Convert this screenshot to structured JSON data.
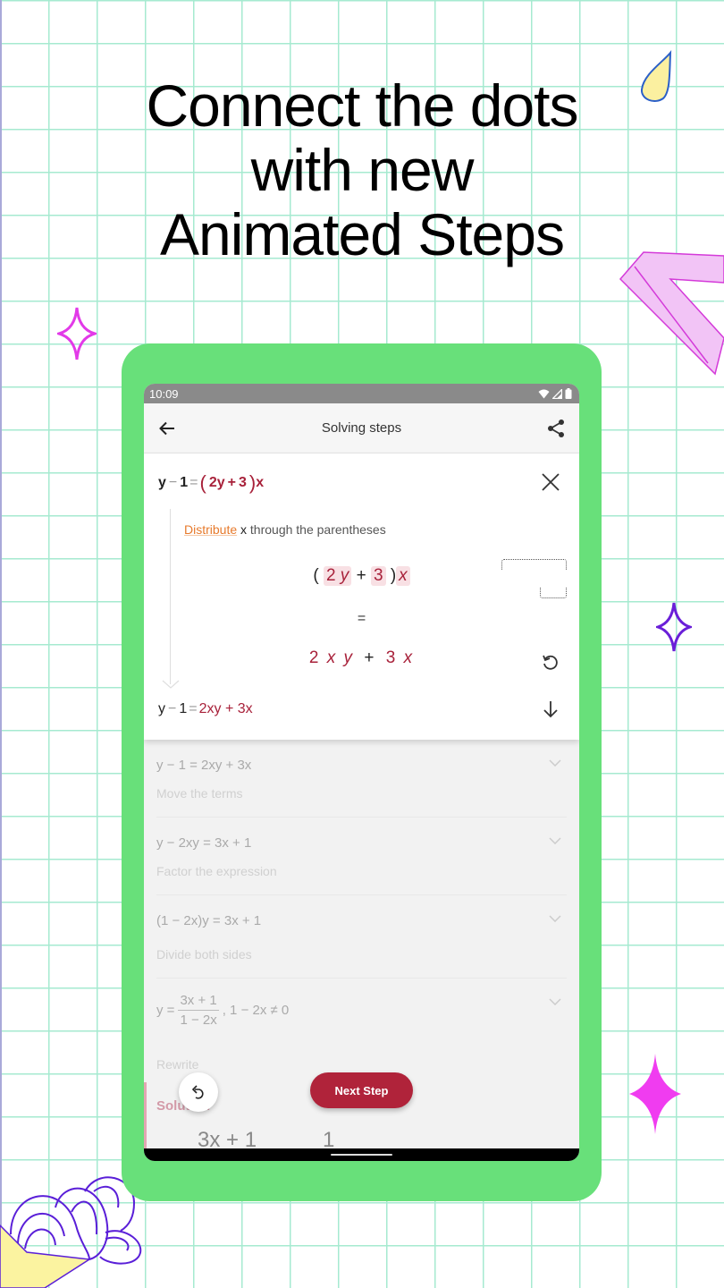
{
  "headline": {
    "line1": "Connect the dots",
    "line2": "with new",
    "line3": "Animated Steps"
  },
  "colors": {
    "frame_green": "#68e07a",
    "grid_line": "#a6ead0",
    "accent_red": "#b0233a",
    "math_red": "#a8213a",
    "keyword_orange": "#e77a2c"
  },
  "status_bar": {
    "time": "10:09",
    "icons": [
      "wifi-icon",
      "signal-icon",
      "battery-icon"
    ]
  },
  "app_bar": {
    "back_icon": "arrow-left-icon",
    "title": "Solving steps",
    "share_icon": "share-icon"
  },
  "active_step": {
    "equation": {
      "lhs_y": "y",
      "minus": "−",
      "one": "1",
      "equals": "=",
      "open_paren": "(",
      "term_2y": "2y",
      "plus": "+",
      "three": "3",
      "close_paren": ")",
      "x": "x"
    },
    "instruction": {
      "keyword": "Distribute",
      "variable": "x",
      "rest": "through the parentheses"
    },
    "animation": {
      "open_paren": "(",
      "term1_coef": "2",
      "term1_var": "y",
      "plus": "+",
      "term2": "3",
      "close_paren": ")",
      "multiplier": "x",
      "equals": "=",
      "result_t1_coef": "2",
      "result_t1_vars": "x y",
      "result_plus": "+",
      "result_t2_coef": "3",
      "result_t2_var": "x"
    },
    "result_equation": {
      "lhs": "y",
      "minus": "−",
      "one": "1",
      "equals": "=",
      "rhs": "2xy + 3x"
    },
    "close_icon": "close-icon",
    "replay_icon": "replay-icon",
    "down_icon": "arrow-down-icon"
  },
  "steps": [
    {
      "equation": "y − 1 = 2xy + 3x",
      "description": "Move the terms"
    },
    {
      "equation": "y − 2xy = 3x + 1",
      "description": "Factor the expression"
    },
    {
      "equation": "(1 − 2x)y = 3x + 1",
      "description": "Divide both sides"
    },
    {
      "equation_lhs": "y =",
      "fraction_numerator": "3x + 1",
      "fraction_denominator": "1 − 2x",
      "condition": ", 1 − 2x ≠ 0",
      "description": "Rewrite"
    }
  ],
  "solution": {
    "label": "Solution",
    "expr_partial_1": "3x + 1",
    "expr_partial_2": "1"
  },
  "buttons": {
    "next_step": "Next Step",
    "undo_icon": "undo-icon"
  }
}
